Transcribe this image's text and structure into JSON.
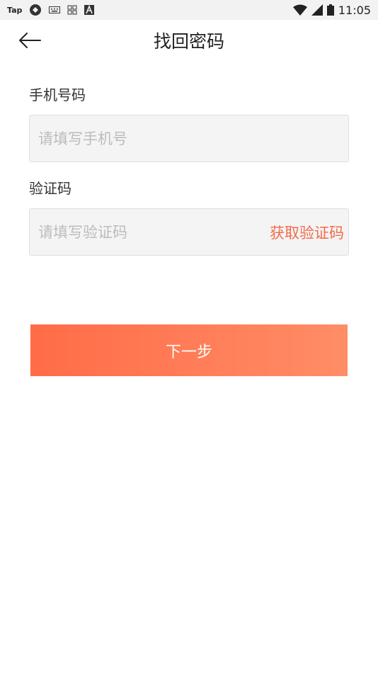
{
  "status_bar": {
    "app_label": "Tap",
    "time": "11:05"
  },
  "header": {
    "title": "找回密码",
    "back_icon": "arrow-left-icon"
  },
  "form": {
    "phone": {
      "label": "手机号码",
      "placeholder": "请填写手机号",
      "value": ""
    },
    "code": {
      "label": "验证码",
      "placeholder": "请填写验证码",
      "value": "",
      "get_code_label": "获取验证码"
    }
  },
  "next_button": {
    "label": "下一步"
  },
  "colors": {
    "accent": "#f26b4a",
    "button_gradient_start": "#ff6c47",
    "button_gradient_end": "#ff8d66",
    "input_background": "#f4f4f4"
  }
}
